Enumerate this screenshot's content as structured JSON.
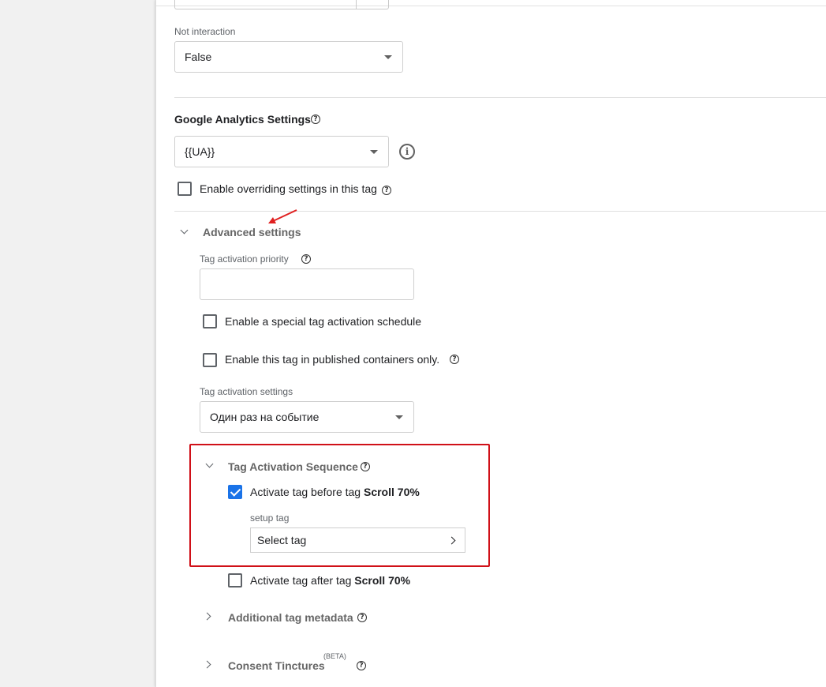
{
  "not_interaction": {
    "label": "Not interaction",
    "value": "False"
  },
  "ga_settings": {
    "title": "Google Analytics Settings",
    "value": "{{UA}}",
    "override_label": "Enable overriding settings in this tag",
    "override_checked": false
  },
  "advanced": {
    "title": "Advanced settings",
    "priority_label": "Tag activation priority",
    "priority_value": "",
    "schedule_label": "Enable a special tag activation schedule",
    "schedule_checked": false,
    "published_label": "Enable this tag in published containers only.",
    "published_checked": false,
    "activation_settings_label": "Tag activation settings",
    "activation_settings_value": "Один раз на событие"
  },
  "sequence": {
    "title": "Tag Activation Sequence",
    "before_prefix": "Activate tag before tag ",
    "before_tag": "Scroll 70%",
    "before_checked": true,
    "setup_label": "setup tag",
    "select_tag": "Select tag",
    "after_prefix": "Activate tag after tag ",
    "after_tag": "Scroll 70%",
    "after_checked": false
  },
  "metadata": {
    "title": "Additional tag metadata"
  },
  "consent": {
    "title": "Consent Tinctures",
    "badge": "(BETA)"
  },
  "colors": {
    "accent": "#1a73e8",
    "highlight": "#d01018",
    "arrow": "#e02020"
  },
  "icons": {
    "help": "question-circle-icon",
    "info": "info-circle-icon",
    "dropdown": "caret-down-icon",
    "expand": "chevron-icon"
  }
}
